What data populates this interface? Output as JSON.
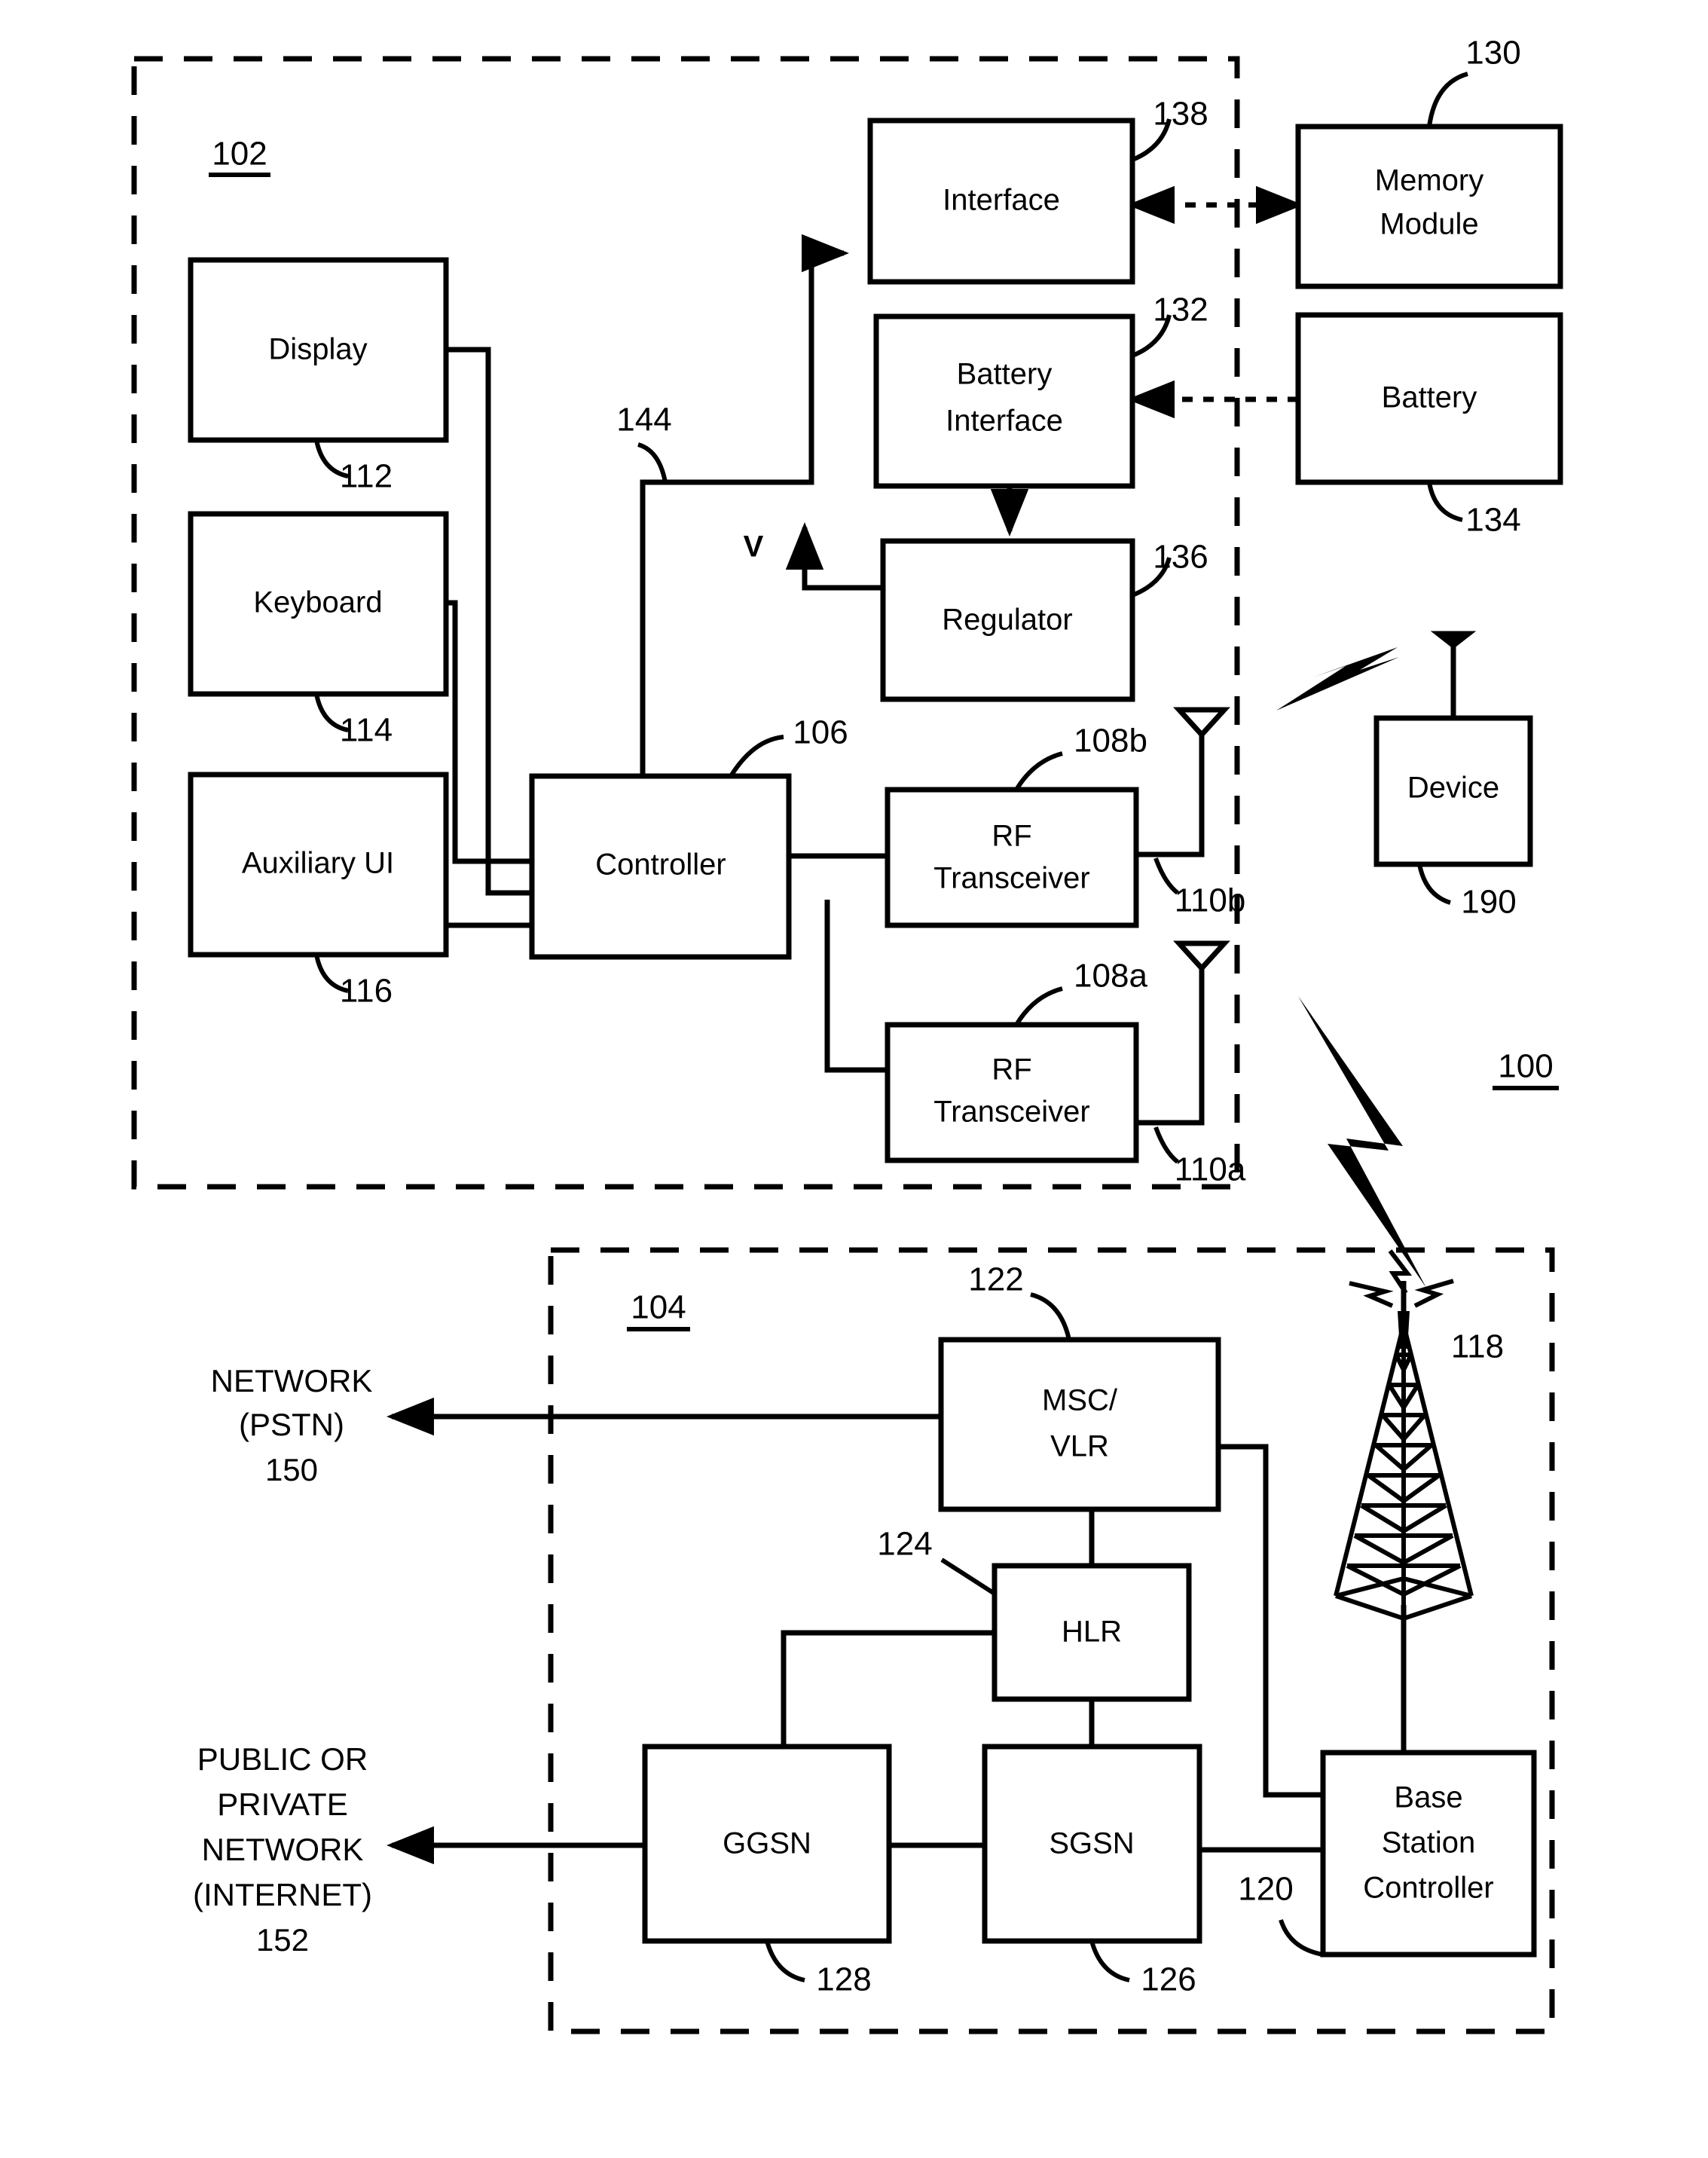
{
  "figure": {
    "system_ref": "100",
    "mobile_device_ref": "102",
    "network_ref": "104"
  },
  "blocks": [
    {
      "id": "display",
      "label": "Display",
      "ref": "112"
    },
    {
      "id": "keyboard",
      "label": "Keyboard",
      "ref": "114"
    },
    {
      "id": "auxui",
      "label": "Auxiliary UI",
      "ref": "116"
    },
    {
      "id": "controller",
      "label": "Controller",
      "ref": "106"
    },
    {
      "id": "interface",
      "label": "Interface",
      "ref": "138"
    },
    {
      "id": "batteryiface",
      "label": "Battery\nInterface",
      "ref": "132"
    },
    {
      "id": "regulator",
      "label": "Regulator",
      "ref": "136"
    },
    {
      "id": "rfb",
      "label": "RF\nTransceiver",
      "ref": "108b"
    },
    {
      "id": "rfa",
      "label": "RF\nTransceiver",
      "ref": "108a"
    },
    {
      "id": "memory",
      "label": "Memory\nModule",
      "ref": "130"
    },
    {
      "id": "battery",
      "label": "Battery",
      "ref": "134"
    },
    {
      "id": "device",
      "label": "Device",
      "ref": "190"
    },
    {
      "id": "mscvlr",
      "label": "MSC/\nVLR",
      "ref": "122"
    },
    {
      "id": "hlr",
      "label": "HLR",
      "ref": "124"
    },
    {
      "id": "ggsn",
      "label": "GGSN",
      "ref": "128"
    },
    {
      "id": "sgsn",
      "label": "SGSN",
      "ref": "126"
    },
    {
      "id": "bsc",
      "label": "Base\nStation\nController",
      "ref": "120"
    }
  ],
  "labels": {
    "display": "Display",
    "keyboard": "Keyboard",
    "auxui": "Auxiliary UI",
    "controller": "Controller",
    "interface": "Interface",
    "battery_interface_l1": "Battery",
    "battery_interface_l2": "Interface",
    "regulator": "Regulator",
    "rf_l1": "RF",
    "rf_l2": "Transceiver",
    "memory_l1": "Memory",
    "memory_l2": "Module",
    "battery": "Battery",
    "device": "Device",
    "msc_l1": "MSC/",
    "msc_l2": "VLR",
    "hlr": "HLR",
    "ggsn": "GGSN",
    "sgsn": "SGSN",
    "bsc_l1": "Base",
    "bsc_l2": "Station",
    "bsc_l3": "Controller",
    "voltage": "V"
  },
  "refs": {
    "system": "100",
    "mobile": "102",
    "network": "104",
    "controller": "106",
    "rf_a": "108a",
    "rf_b": "108b",
    "ant_a": "110a",
    "ant_b": "110b",
    "display": "112",
    "keyboard": "114",
    "auxui": "116",
    "tower": "118",
    "bsc": "120",
    "mscvlr": "122",
    "hlr": "124",
    "sgsn": "126",
    "ggsn": "128",
    "memory": "130",
    "battery_interface": "132",
    "battery": "134",
    "regulator": "136",
    "interface": "138",
    "bus": "144",
    "device": "190"
  },
  "external_networks": [
    {
      "id": "pstn",
      "line1": "NETWORK",
      "line2": "(PSTN)",
      "line3": "",
      "line4": "",
      "ref": "150"
    },
    {
      "id": "internet",
      "line1": "PUBLIC OR",
      "line2": "PRIVATE",
      "line3": "NETWORK",
      "line4": "(INTERNET)",
      "ref": "152"
    }
  ],
  "colors": {
    "stroke": "#000000",
    "background": "#ffffff"
  }
}
